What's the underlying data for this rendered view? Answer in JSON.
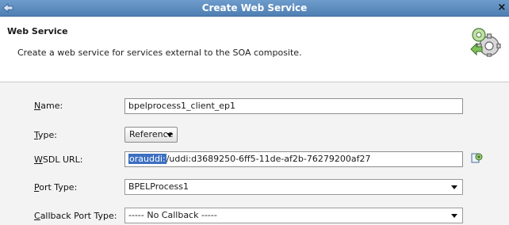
{
  "window": {
    "title": "Create Web Service",
    "close_glyph": "×"
  },
  "header": {
    "title": "Web Service",
    "description": "Create a web service for services external to the SOA composite."
  },
  "form": {
    "name": {
      "label_mnemonic": "N",
      "label_rest": "ame:",
      "value": "bpelprocess1_client_ep1"
    },
    "type": {
      "label_mnemonic": "T",
      "label_rest": "ype:",
      "value": "Reference"
    },
    "wsdl": {
      "label_mnemonic": "W",
      "label_rest": "SDL URL:",
      "value_selected": "orauddi:",
      "value_rest": "/uddi:d3689250-6ff5-11de-af2b-76279200af27"
    },
    "port_type": {
      "label_mnemonic": "P",
      "label_rest": "ort Type:",
      "value": "BPELProcess1"
    },
    "callback_port_type": {
      "label_mnemonic": "C",
      "label_rest": "allback Port Type:",
      "value": "----- No Callback -----"
    }
  },
  "icons": {
    "window_icon": "arrow-window-icon",
    "header_icon": "web-service-gears-icon",
    "browse_icon": "browse-uddi-icon"
  },
  "colors": {
    "titlebar": "#5a88bd",
    "selection": "#3d6fc2"
  }
}
